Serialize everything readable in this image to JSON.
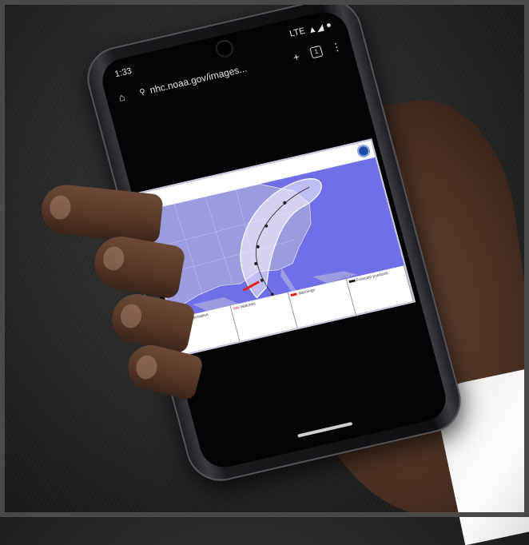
{
  "status_bar": {
    "time": "1:33",
    "network": "LTE",
    "signal": "▲◢",
    "battery": "●"
  },
  "browser": {
    "url": "nhc.noaa.gov/images...",
    "tab_count": "1"
  },
  "map": {
    "legend": [
      "Current Information",
      "Watches",
      "Warnings",
      "Forecast positions"
    ]
  },
  "colors": {
    "ocean": "#6f6fe8",
    "land": "#9b9be0",
    "cone": "#ffffff",
    "storm_center": "#d9c42a",
    "warning_red": "#e02020",
    "skin": "#5a3a2a"
  }
}
